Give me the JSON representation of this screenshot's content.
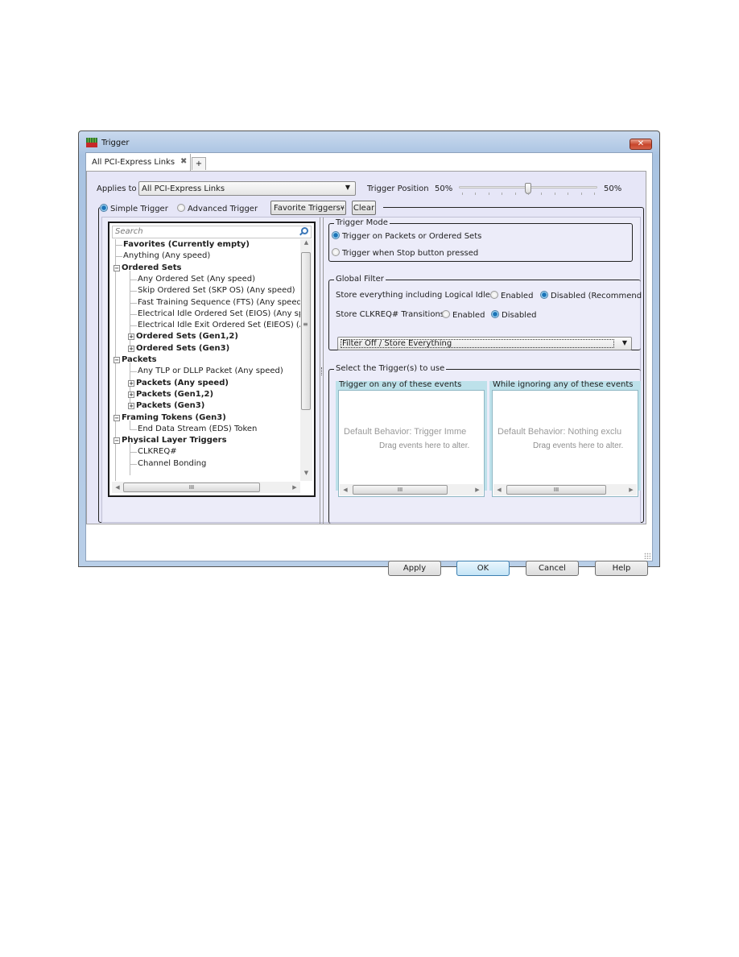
{
  "window": {
    "title": "Trigger",
    "close_glyph": "✕"
  },
  "tabs": [
    {
      "label": "All PCI-Express Links",
      "close_glyph": "✖"
    }
  ],
  "add_tab_glyph": "+",
  "applies": {
    "label": "Applies to",
    "value": "All PCI-Express Links",
    "arrow": "▼"
  },
  "trigger_position": {
    "label": "Trigger Position",
    "left_value": "50%",
    "right_value": "50%",
    "value_percent": 50
  },
  "mode_bar": {
    "simple": {
      "label": "Simple Trigger",
      "selected": true
    },
    "advanced": {
      "label": "Advanced Trigger",
      "selected": false
    },
    "favorite_button": "Favorite Triggers",
    "favorite_glyph": "¥",
    "clear_button": "Clear"
  },
  "search": {
    "placeholder": "Search"
  },
  "tree": [
    {
      "label": "Favorites (Currently empty)",
      "level": 0,
      "bold": true,
      "expander": ""
    },
    {
      "label": "Anything (Any speed)",
      "level": 0,
      "bold": false,
      "expander": ""
    },
    {
      "label": "Ordered Sets",
      "level": 0,
      "bold": true,
      "expander": "−"
    },
    {
      "label": "Any Ordered Set (Any speed)",
      "level": 1,
      "bold": false,
      "expander": ""
    },
    {
      "label": "Skip Ordered Set (SKP OS) (Any speed)",
      "level": 1,
      "bold": false,
      "expander": ""
    },
    {
      "label": "Fast Training Sequence (FTS) (Any speed)",
      "level": 1,
      "bold": false,
      "expander": ""
    },
    {
      "label": "Electrical Idle Ordered Set (EIOS) (Any spe",
      "level": 1,
      "bold": false,
      "expander": ""
    },
    {
      "label": "Electrical Idle Exit Ordered Set (EIEOS) (Ar",
      "level": 1,
      "bold": false,
      "expander": ""
    },
    {
      "label": "Ordered Sets (Gen1,2)",
      "level": 1,
      "bold": true,
      "expander": "+"
    },
    {
      "label": "Ordered Sets (Gen3)",
      "level": 1,
      "bold": true,
      "expander": "+"
    },
    {
      "label": "Packets",
      "level": 0,
      "bold": true,
      "expander": "−"
    },
    {
      "label": "Any TLP or DLLP Packet (Any speed)",
      "level": 1,
      "bold": false,
      "expander": ""
    },
    {
      "label": "Packets (Any speed)",
      "level": 1,
      "bold": true,
      "expander": "+"
    },
    {
      "label": "Packets (Gen1,2)",
      "level": 1,
      "bold": true,
      "expander": "+"
    },
    {
      "label": "Packets (Gen3)",
      "level": 1,
      "bold": true,
      "expander": "+"
    },
    {
      "label": "Framing Tokens (Gen3)",
      "level": 0,
      "bold": true,
      "expander": "−"
    },
    {
      "label": "End Data Stream (EDS) Token",
      "level": 1,
      "bold": false,
      "expander": ""
    },
    {
      "label": "Physical Layer Triggers",
      "level": 0,
      "bold": true,
      "expander": "−"
    },
    {
      "label": "CLKREQ#",
      "level": 1,
      "bold": false,
      "expander": ""
    },
    {
      "label": "Channel Bonding",
      "level": 1,
      "bold": false,
      "expander": ""
    }
  ],
  "scroll_glyphs": {
    "up": "▲",
    "down": "▼",
    "left": "◀",
    "right": "▶",
    "grip_h": "III",
    "grip_v": "≡"
  },
  "trigger_mode": {
    "title": "Trigger Mode",
    "options": [
      {
        "label": "Trigger on Packets or Ordered Sets",
        "selected": true
      },
      {
        "label": "Trigger when Stop button pressed",
        "selected": false
      }
    ]
  },
  "global_filter": {
    "title": "Global Filter",
    "idles": {
      "label": "Store everything including Logical Idles",
      "enabled": "Enabled",
      "disabled": "Disabled (Recommend",
      "selected": "disabled"
    },
    "clkreq": {
      "label": "Store CLKREQ# Transitions",
      "enabled": "Enabled",
      "disabled": "Disabled",
      "selected": "disabled"
    },
    "filter_value": "Filter Off / Store Everything",
    "arrow": "▼"
  },
  "select_triggers": {
    "title": "Select the Trigger(s) to use",
    "trigger_on": {
      "title": "Trigger on any of these events",
      "main": "Default Behavior: Trigger Imme",
      "sub": "Drag events here to alter."
    },
    "ignoring": {
      "title": "While ignoring any of these events",
      "main": "Default Behavior: Nothing exclu",
      "sub": "Drag events here to alter."
    }
  },
  "footer": {
    "apply": "Apply",
    "ok": "OK",
    "cancel": "Cancel",
    "help": "Help"
  }
}
